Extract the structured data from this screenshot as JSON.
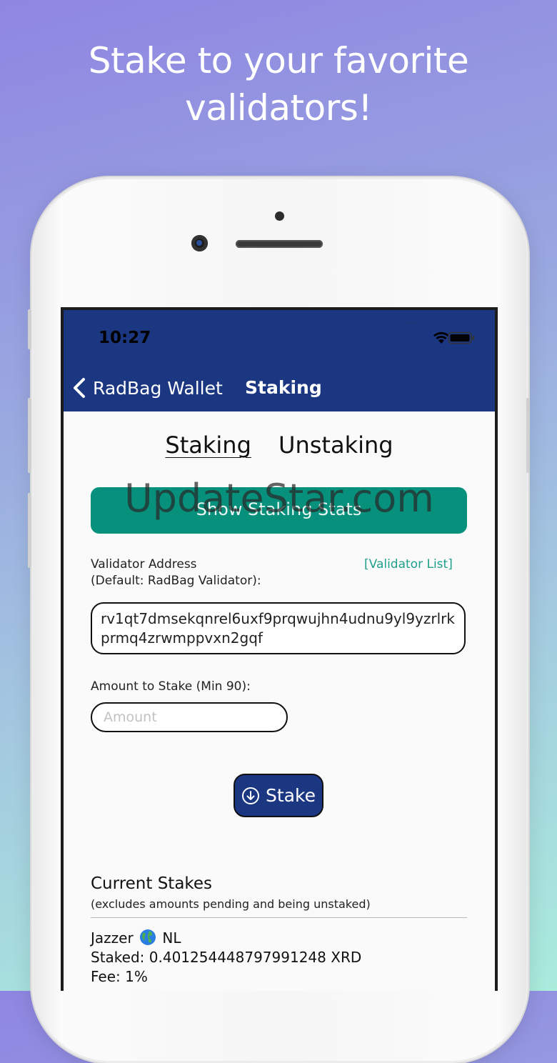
{
  "headline": {
    "line1": "Stake to your favorite",
    "line2": "validators!"
  },
  "status_bar": {
    "time": "10:27",
    "signal": "....",
    "icons": [
      "wifi-icon",
      "battery-icon"
    ]
  },
  "nav": {
    "back_label": "RadBag Wallet",
    "title": "Staking"
  },
  "tabs": [
    {
      "label": "Staking",
      "active": true
    },
    {
      "label": "Unstaking",
      "active": false
    }
  ],
  "stats_button_label": "Show Staking Stats",
  "watermark": "UpdateStar.com",
  "validator": {
    "label_line1": "Validator Address",
    "label_line2": "(Default: RadBag Validator):",
    "list_link": "[Validator List]",
    "address": "rv1qt7dmsekqnrel6uxf9prqwujhn4udnu9yl9yzrlrkprmq4zrwmppvxn2gqf"
  },
  "amount": {
    "label": "Amount to Stake (Min 90):",
    "placeholder": "Amount",
    "value": ""
  },
  "stake_button_label": "Stake",
  "current_stakes": {
    "title": "Current Stakes",
    "subtitle": "(excludes amounts pending and being unstaked)",
    "items": [
      {
        "name": "Jazzer",
        "country": "NL",
        "staked": "Staked: 0.401254448797991248 XRD",
        "fee": "Fee: 1%"
      }
    ]
  },
  "colors": {
    "nav_blue": "#1b3782",
    "teal": "#07917c",
    "link_teal": "#1fa08c"
  }
}
